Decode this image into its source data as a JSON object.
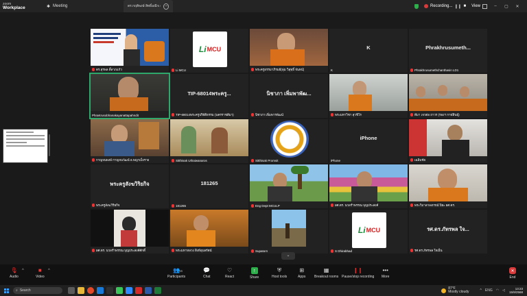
{
  "titlebar": {
    "brand_top": "zoom",
    "brand_bottom": "Workplace",
    "meeting_tab": "Meeting",
    "share_tab": "ดร.กฤติพงษ์ สิทธิ์มณี's screen",
    "recording": "Recording...",
    "view": "View"
  },
  "tiles": [
    {
      "id": "t1",
      "name": "ดร.สุรพล ลี้ลาภแก้ว"
    },
    {
      "id": "t2",
      "name": "Li MCU"
    },
    {
      "id": "t3",
      "name": "พระครูธรรมาภิรมย์(พุ่ม วิสุทฺธิ์ จันทน์)"
    },
    {
      "id": "t4",
      "name": "K",
      "big": "K"
    },
    {
      "id": "t5",
      "name": "Phrakhrusumethchanthasin LD1",
      "big": "Phrakhrusumeth..."
    },
    {
      "id": "t6",
      "name": "PhraKrusobhanakayanattapahndit"
    },
    {
      "id": "t7",
      "name": "TIP-68014พระครูปริยัติธรรม (นครราชสีมา)",
      "big": "TIP-68014พระครู..."
    },
    {
      "id": "t8",
      "name": "นิชาภา เพิ่มพารพัฒน์",
      "big": "นิชาภา เพิ่มพาพัฒ..."
    },
    {
      "id": "t9",
      "name": "พระมหาวิชา สุวชิโร"
    },
    {
      "id": "t10",
      "name": "ดีมา เจวต่อ ถาวร (รองฯ กาฬสินธุ์)"
    },
    {
      "id": "t11",
      "name": "กาญจนพงษ์ กาญจนวัฒน์ อ.พญาเม็งราย"
    },
    {
      "id": "t12",
      "name": "Sitthisak Uthaiwanaros"
    },
    {
      "id": "t13",
      "name": "Sitthisak Promsit"
    },
    {
      "id": "t14",
      "name": "iPhone",
      "big": "iPhone"
    },
    {
      "id": "t15",
      "name": "เฉลิมชัย"
    },
    {
      "id": "t16",
      "name": "พระครูสังฆวิริยกิจ",
      "big": "พระครูสังฆวิริยกิจ"
    },
    {
      "id": "t17",
      "name": "181265",
      "big": "181265"
    },
    {
      "id": "t18",
      "name": "Eng Dept MCULP"
    },
    {
      "id": "t19",
      "name": "ผศ.ดร. นวลรำพรรณ บุญประสงค์"
    },
    {
      "id": "t20",
      "name": "พระวิมาลาลงกรณ์ ปิยะ ผศ.ดร."
    },
    {
      "id": "t21",
      "name": "ผศ.ดร. นวลรำพรรณ บุญประสงค์ศักดิ์"
    },
    {
      "id": "t22",
      "name": "พระมหาหลวง สิงห์อุบลรัตน์"
    },
    {
      "id": "t23",
      "name": "Supatorn"
    },
    {
      "id": "t24",
      "name": "S Dhirabhad"
    },
    {
      "id": "t25",
      "name": "รศ.ดร.ภัทรพล ใจเย็น",
      "big": "รศ.ดร.ภัทรพล ใจ..."
    }
  ],
  "toolbar": {
    "audio": "Audio",
    "video": "Video",
    "participants": "Participants",
    "participants_count": "56",
    "chat": "Chat",
    "react": "React",
    "share": "Share",
    "host_tools": "Host tools",
    "apps": "Apps",
    "breakout": "Breakout rooms",
    "record": "Pause/stop recording",
    "more": "More",
    "end": "End"
  },
  "taskbar": {
    "search_placeholder": "Search",
    "weather_temp": "87°F",
    "weather_desc": "Mostly cloudy",
    "time": "13:23",
    "date": "15/9/2568"
  },
  "colors": {
    "accent_green": "#2ea86b",
    "record_red": "#d83b3b",
    "bg": "#1a1a1a"
  }
}
